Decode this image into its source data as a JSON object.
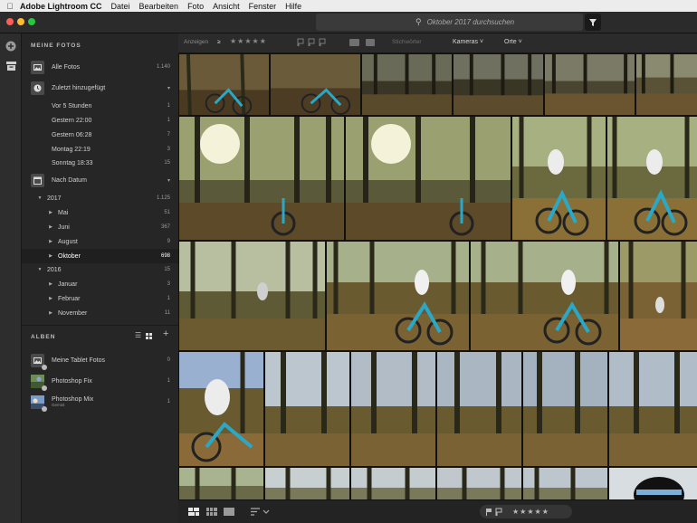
{
  "menubar": {
    "app_name": "Adobe Lightroom CC",
    "items": [
      "Datei",
      "Bearbeiten",
      "Foto",
      "Ansicht",
      "Fenster",
      "Hilfe"
    ]
  },
  "search": {
    "value": "Oktober 2017 durchsuchen"
  },
  "sidebar": {
    "my_photos_title": "MEINE FOTOS",
    "all_photos": {
      "label": "Alle Fotos",
      "count": "1.140"
    },
    "recently_added": {
      "label": "Zuletzt hinzugefügt"
    },
    "recent_items": [
      {
        "label": "Vor 5 Stunden",
        "count": "1"
      },
      {
        "label": "Gestern 22:00",
        "count": "1"
      },
      {
        "label": "Gestern 06:28",
        "count": "7"
      },
      {
        "label": "Montag 22:19",
        "count": "3"
      },
      {
        "label": "Sonntag 18:33",
        "count": "15"
      }
    ],
    "by_date": {
      "label": "Nach Datum"
    },
    "years": [
      {
        "label": "2017",
        "count": "1.125",
        "months": [
          {
            "label": "Mai",
            "count": "51"
          },
          {
            "label": "Juni",
            "count": "367"
          },
          {
            "label": "August",
            "count": "9"
          },
          {
            "label": "Oktober",
            "count": "698"
          }
        ]
      },
      {
        "label": "2016",
        "count": "15",
        "months": [
          {
            "label": "Januar",
            "count": "3"
          },
          {
            "label": "Februar",
            "count": "1"
          },
          {
            "label": "November",
            "count": "11"
          }
        ]
      }
    ],
    "albums_title": "ALBEN",
    "albums": [
      {
        "label": "Meine Tablet Fotos",
        "count": "0",
        "sub": ""
      },
      {
        "label": "Photoshop Fix",
        "count": "1",
        "sub": ""
      },
      {
        "label": "Photoshop Mix",
        "count": "1",
        "sub": "Gemixt"
      }
    ]
  },
  "toolbar": {
    "show_label": "Anzeigen",
    "rating_op": "≥",
    "keywords": "Stichwörter",
    "cameras": "Kameras",
    "places": "Orte"
  },
  "colors": {
    "accent": "#ffffff",
    "panel": "#262626",
    "grid_bg": "#111111"
  }
}
